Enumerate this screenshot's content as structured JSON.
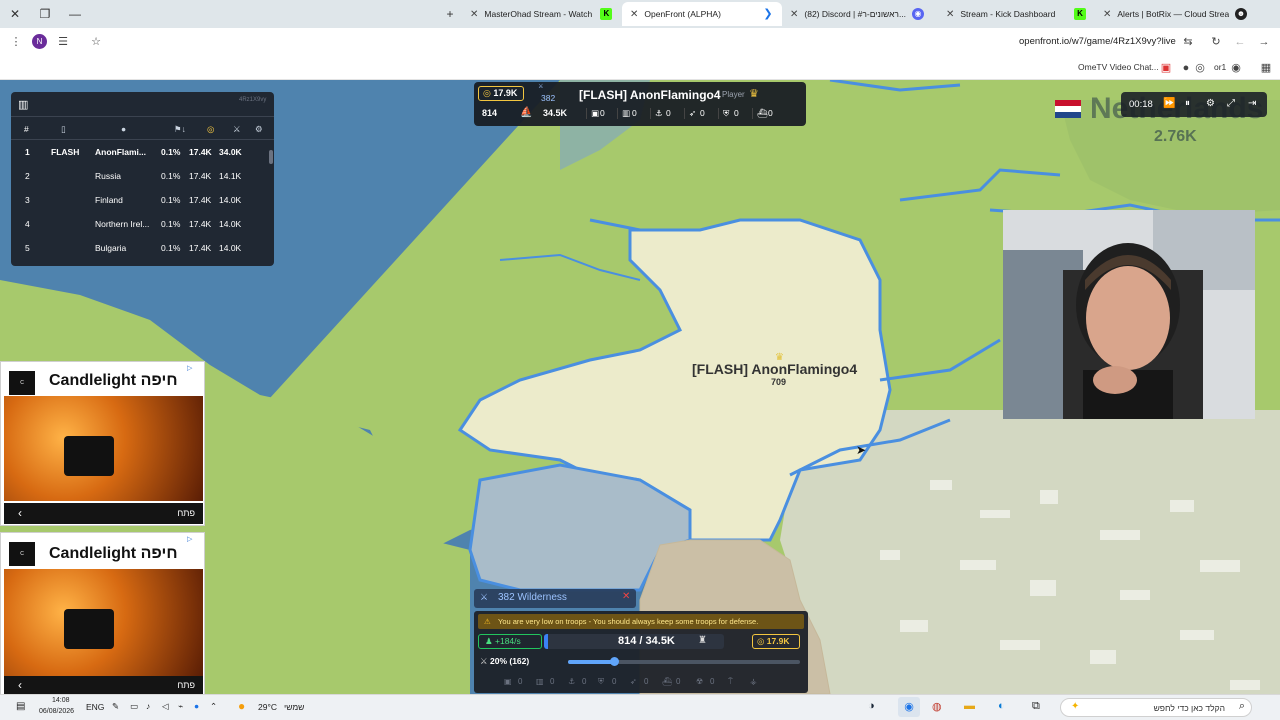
{
  "browser": {
    "tabs": [
      {
        "title": "MasterOhad Stream - Watch Li",
        "favicon_color": "#53fc18",
        "active": false
      },
      {
        "title": "OpenFront (ALPHA)",
        "favicon_color": "#1a73e8",
        "active": true
      },
      {
        "title": "(82) Discord | #ראשונים-ר...",
        "favicon_color": "#5865f2",
        "active": false
      },
      {
        "title": "Stream - Kick Dashboard",
        "favicon_color": "#53fc18",
        "active": false
      },
      {
        "title": "Alerts | BotRix — Cloud Stream",
        "favicon_color": "#222222",
        "active": false
      }
    ],
    "profile_initial": "N",
    "url": "openfront.io/w7/game/4Rz1X9vy?live",
    "bookmarks": [
      "OmeTV Video Chat...",
      "or1"
    ]
  },
  "leaderboard": {
    "game_id": "4Rz1X9vy",
    "headers": [
      "#",
      "",
      "",
      "",
      "",
      "",
      ""
    ],
    "rows": [
      {
        "rank": "1",
        "clan": "FLASH",
        "name": "AnonFlami...",
        "territory": "0.1%",
        "gold": "17.4K",
        "troops": "34.0K",
        "highlight": true
      },
      {
        "rank": "2",
        "clan": "",
        "name": "Russia",
        "territory": "0.1%",
        "gold": "17.4K",
        "troops": "14.1K",
        "highlight": false
      },
      {
        "rank": "3",
        "clan": "",
        "name": "Finland",
        "territory": "0.1%",
        "gold": "17.4K",
        "troops": "14.0K",
        "highlight": false
      },
      {
        "rank": "4",
        "clan": "",
        "name": "Northern Irel...",
        "territory": "0.1%",
        "gold": "17.4K",
        "troops": "14.0K",
        "highlight": false
      },
      {
        "rank": "5",
        "clan": "",
        "name": "Bulgaria",
        "territory": "0.1%",
        "gold": "17.4K",
        "troops": "14.0K",
        "highlight": false
      }
    ]
  },
  "player_bar": {
    "gold": "17.9K",
    "attacks": "382",
    "name": "[FLASH] AnonFlamingo4",
    "role": "Player",
    "troops": "814",
    "max_troops": "34.5K",
    "buildings": [
      "0",
      "0",
      "0",
      "0",
      "0",
      "0"
    ]
  },
  "controls": {
    "time": "00:18"
  },
  "map": {
    "nation_name": "Netherlands",
    "nation_value": "2.76K",
    "player_label": "[FLASH] AnonFlamingo4",
    "player_value": "709"
  },
  "ads": [
    {
      "title": "Candlelight חיפה",
      "button": "פתח"
    },
    {
      "title": "Candlelight חיפה",
      "button": "פתח"
    }
  ],
  "hud": {
    "attack_target": "382 Wilderness",
    "warning": "You are very low on troops - You should always keep some troops for defense.",
    "rate": "+184/s",
    "troops": "814 / 34.5K",
    "troops_fraction": 0.024,
    "gold": "17.9K",
    "attack_ratio": "20% (162)",
    "attack_ratio_fraction": 0.2,
    "build_counts": [
      "0",
      "0",
      "0",
      "0",
      "0",
      "0",
      "0"
    ]
  },
  "taskbar": {
    "time": "14:08",
    "date": "06/08/2026",
    "lang": "ENG",
    "weather": "29°C",
    "weather_text": "שמשי",
    "search": "הקלד כאן כדי לחפש"
  },
  "colors": {
    "sea": "#4f83ae",
    "land": "#a8c96c",
    "player_territory": "#ecebcb",
    "border": "#4a8fe0",
    "hud_bg": "#1e242c",
    "gold": "#f3c640",
    "warning_bg": "#7a5a10"
  }
}
